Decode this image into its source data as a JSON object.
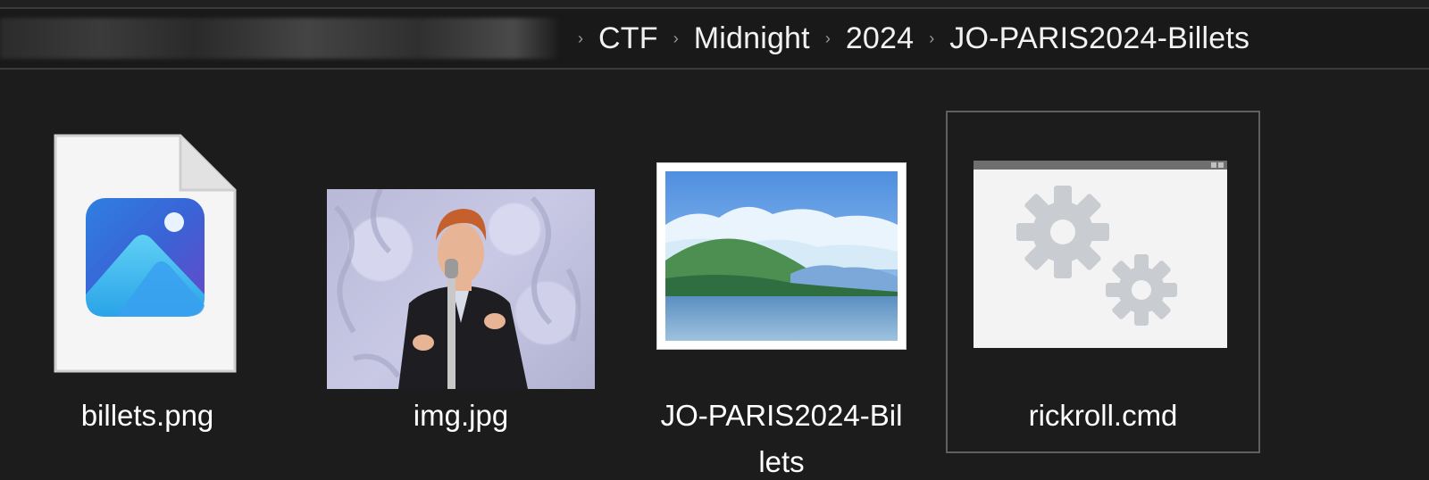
{
  "address_bar": {
    "breadcrumbs": [
      "CTF",
      "Midnight",
      "2024",
      "JO-PARIS2024-Billets"
    ],
    "separator_glyph": "›"
  },
  "files": [
    {
      "name": "billets.png",
      "icon": "image-file-icon"
    },
    {
      "name": "img.jpg",
      "icon": "photo-thumbnail"
    },
    {
      "name_line1": "JO-PARIS2024-Bil",
      "name_line2": "lets",
      "icon": "landscape-image-icon"
    },
    {
      "name": "rickroll.cmd",
      "icon": "gears-icon",
      "selected": true
    }
  ],
  "colors": {
    "background": "#1c1c1c",
    "selection_border": "#5f5f5f",
    "text": "#ffffff"
  }
}
